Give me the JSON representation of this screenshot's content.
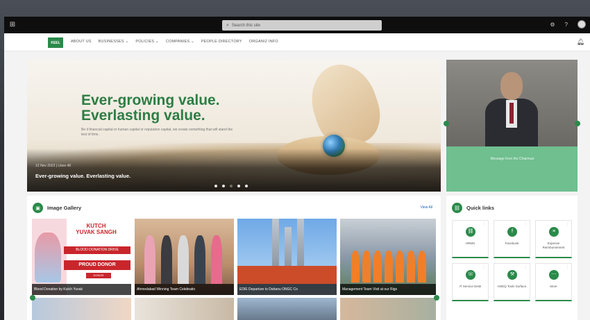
{
  "topbar": {
    "search_placeholder": "Search this site"
  },
  "nav": {
    "logo": "KEEL",
    "items": [
      "ABOUT US",
      "BUSINESSES",
      "POLICIES",
      "COMPANIES",
      "PEOPLE DIRECTORY",
      "ORGANIZ INFO"
    ]
  },
  "hero": {
    "title_line1": "Ever-growing value.",
    "title_line2": "Everlasting value.",
    "subtitle": "Be it financial capital or human capital or reputation capital, we create something that will stand the test of time.",
    "meta": "12 Nov 2022  |  Likes 48",
    "caption": "Ever-growing value. Everlasting value."
  },
  "profile": {
    "text": "Message from the Chairman"
  },
  "gallery": {
    "title": "Image Gallery",
    "view_all": "View All",
    "tiles": [
      {
        "caption": "Blood Donation by Kutch Yuvak"
      },
      {
        "caption": "Ahmedabad Winning Team Celebratio"
      },
      {
        "caption": "EDIE Departure to Dahanu ONGC Co"
      },
      {
        "caption": "Management Team Visit at our Rigs"
      }
    ],
    "poster": {
      "line1": "KUTCH",
      "line2": "YUVAK SANGH",
      "band1": "BLOOD DONATION DRIVE",
      "band2": "PROUD DONOR",
      "band3": "DONOR"
    }
  },
  "quick_links": {
    "title": "Quick links",
    "items": [
      {
        "label": "HRMS",
        "icon": "link-icon"
      },
      {
        "label": "Facebook",
        "icon": "facebook-icon"
      },
      {
        "label": "Expense Reimbursement",
        "icon": "receipt-icon"
      },
      {
        "label": "IT Service Desk",
        "icon": "headset-icon"
      },
      {
        "label": "HSEQ Tools Surface",
        "icon": "tools-icon"
      },
      {
        "label": "More",
        "icon": "more-icon"
      }
    ]
  },
  "colors": {
    "brand_green": "#2a8a4a",
    "topbar": "#0e0e0e"
  }
}
